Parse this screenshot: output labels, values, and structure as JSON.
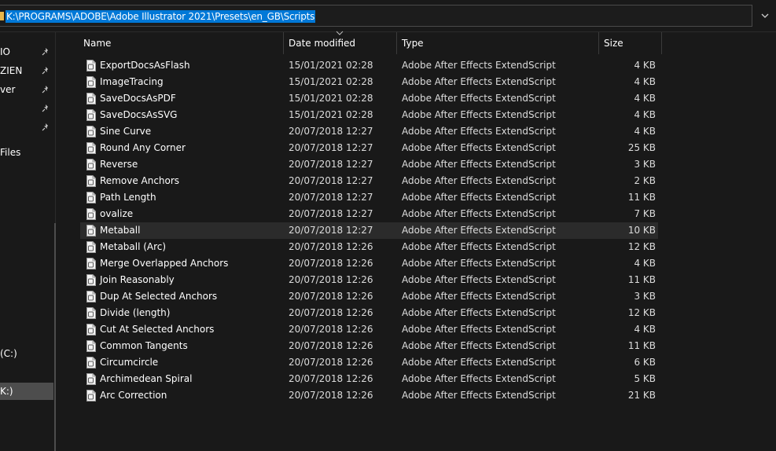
{
  "address": {
    "path": "K:\\PROGRAMS\\ADOBE\\Adobe Illustrator 2021\\Presets\\en_GB\\Scripts"
  },
  "nav": {
    "items": [
      {
        "label": "IO",
        "pinned": true
      },
      {
        "label": "ZIEN",
        "pinned": true
      },
      {
        "label": "ver",
        "pinned": true
      },
      {
        "label": "",
        "pinned": true
      },
      {
        "label": "",
        "pinned": true
      },
      {
        "label": "Files",
        "pinned": false
      },
      {
        "label": "(C:)",
        "pinned": false
      },
      {
        "label": "K:)",
        "pinned": false,
        "selected": true
      }
    ]
  },
  "columns": {
    "name": "Name",
    "date": "Date modified",
    "type": "Type",
    "size": "Size"
  },
  "files": [
    {
      "name": "ExportDocsAsFlash",
      "date": "15/01/2021 02:28",
      "type": "Adobe After Effects ExtendScript",
      "size": "4 KB"
    },
    {
      "name": "ImageTracing",
      "date": "15/01/2021 02:28",
      "type": "Adobe After Effects ExtendScript",
      "size": "4 KB"
    },
    {
      "name": "SaveDocsAsPDF",
      "date": "15/01/2021 02:28",
      "type": "Adobe After Effects ExtendScript",
      "size": "4 KB"
    },
    {
      "name": "SaveDocsAsSVG",
      "date": "15/01/2021 02:28",
      "type": "Adobe After Effects ExtendScript",
      "size": "4 KB"
    },
    {
      "name": "Sine Curve",
      "date": "20/07/2018 12:27",
      "type": "Adobe After Effects ExtendScript",
      "size": "4 KB"
    },
    {
      "name": "Round Any Corner",
      "date": "20/07/2018 12:27",
      "type": "Adobe After Effects ExtendScript",
      "size": "25 KB"
    },
    {
      "name": "Reverse",
      "date": "20/07/2018 12:27",
      "type": "Adobe After Effects ExtendScript",
      "size": "3 KB"
    },
    {
      "name": "Remove Anchors",
      "date": "20/07/2018 12:27",
      "type": "Adobe After Effects ExtendScript",
      "size": "2 KB"
    },
    {
      "name": "Path Length",
      "date": "20/07/2018 12:27",
      "type": "Adobe After Effects ExtendScript",
      "size": "11 KB"
    },
    {
      "name": "ovalize",
      "date": "20/07/2018 12:27",
      "type": "Adobe After Effects ExtendScript",
      "size": "7 KB"
    },
    {
      "name": "Metaball",
      "date": "20/07/2018 12:27",
      "type": "Adobe After Effects ExtendScript",
      "size": "10 KB"
    },
    {
      "name": "Metaball (Arc)",
      "date": "20/07/2018 12:26",
      "type": "Adobe After Effects ExtendScript",
      "size": "12 KB"
    },
    {
      "name": "Merge Overlapped Anchors",
      "date": "20/07/2018 12:26",
      "type": "Adobe After Effects ExtendScript",
      "size": "4 KB"
    },
    {
      "name": "Join Reasonably",
      "date": "20/07/2018 12:26",
      "type": "Adobe After Effects ExtendScript",
      "size": "11 KB"
    },
    {
      "name": "Dup At Selected Anchors",
      "date": "20/07/2018 12:26",
      "type": "Adobe After Effects ExtendScript",
      "size": "3 KB"
    },
    {
      "name": "Divide (length)",
      "date": "20/07/2018 12:26",
      "type": "Adobe After Effects ExtendScript",
      "size": "12 KB"
    },
    {
      "name": "Cut At Selected Anchors",
      "date": "20/07/2018 12:26",
      "type": "Adobe After Effects ExtendScript",
      "size": "4 KB"
    },
    {
      "name": "Common Tangents",
      "date": "20/07/2018 12:26",
      "type": "Adobe After Effects ExtendScript",
      "size": "11 KB"
    },
    {
      "name": "Circumcircle",
      "date": "20/07/2018 12:26",
      "type": "Adobe After Effects ExtendScript",
      "size": "6 KB"
    },
    {
      "name": "Archimedean Spiral",
      "date": "20/07/2018 12:26",
      "type": "Adobe After Effects ExtendScript",
      "size": "5 KB"
    },
    {
      "name": "Arc Correction",
      "date": "20/07/2018 12:26",
      "type": "Adobe After Effects ExtendScript",
      "size": "21 KB"
    }
  ],
  "hovered_file": "Metaball",
  "colors": {
    "background": "#191919",
    "selection": "#0078d7",
    "hover_row": "#2b2b2b",
    "nav_selected": "#4d4d4d"
  }
}
